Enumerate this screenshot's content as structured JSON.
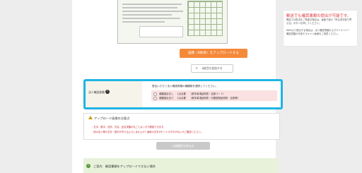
{
  "warning": {
    "title": "郵送でも確認書類の提出が可能です。",
    "lines": [
      "郵送での提出をご希望の場合は、画面下部の「申込書を取り寄",
      "せる」ボタンを押してください。",
      "",
      "WEBより提出する場合は、法人確認書類およびマイナンバー",
      "確認書類の写真やスキャン画像をご用意ください。"
    ]
  },
  "upload": {
    "button_label": "画像（8枚目）をアップロードする",
    "add_label": "8枚目を追加する",
    "add_icon": "plus-icon"
  },
  "corporate": {
    "label": "法人確認書類",
    "help_icon": "?",
    "instruction": "提出いただく法人確認書類の種類数を選択してください。",
    "options": [
      {
        "status": "種類指定なし",
        "count": "1点必要",
        "docs": "（謄本事項証明書・定款コード）"
      },
      {
        "status": "種類指定あり",
        "count": "2点必要",
        "docs": "（謄本事項証明書・印鑑登録証明書・定款等）"
      }
    ]
  },
  "notes": {
    "title": "アップロード画像の注意点",
    "items": [
      "・文字、数字、住所、氏名、記名書類が丸ごとはっきり確認できます。",
      "・他の法人等の文字・数字が写り込んでいませんか？画像の文字がピントのずれがないかご確認ください。"
    ]
  },
  "submit": {
    "label": "口座開設を申込む"
  },
  "guide": {
    "title": "ご案内　確認書類をアップロードできない場合",
    "icon": "info-icon"
  },
  "colors": {
    "accent": "#1fb4e2",
    "upload": "#f5893a",
    "warning": "#e0383e",
    "guide": "#e8f1da"
  }
}
